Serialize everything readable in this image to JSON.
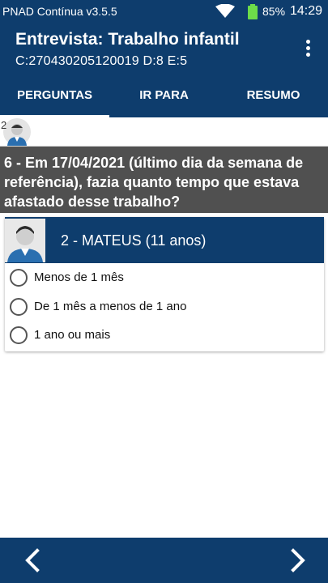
{
  "status_bar": {
    "app_version": "PNAD Contínua v3.5.5",
    "battery": "85%",
    "time": "14:29"
  },
  "app_bar": {
    "title": "Entrevista: Trabalho infantil",
    "subtitle": "C:270430205120019 D:8 E:5"
  },
  "tabs": [
    {
      "label": "PERGUNTAS",
      "active": true
    },
    {
      "label": "IR PARA",
      "active": false
    },
    {
      "label": "RESUMO",
      "active": false
    }
  ],
  "avatar_strip": {
    "number": "2"
  },
  "question": {
    "text": "6 - Em 17/04/2021 (último dia da semana de referência), fazia quanto tempo que estava afastado desse trabalho?"
  },
  "person": {
    "name": "2 - MATEUS (11 anos)"
  },
  "options": [
    {
      "label": "Menos de 1 mês",
      "selected": false
    },
    {
      "label": "De 1 mês a menos de 1 ano",
      "selected": false
    },
    {
      "label": "1 ano ou mais",
      "selected": false
    }
  ],
  "colors": {
    "primary": "#0e3d6d",
    "question_bg": "#505050"
  }
}
